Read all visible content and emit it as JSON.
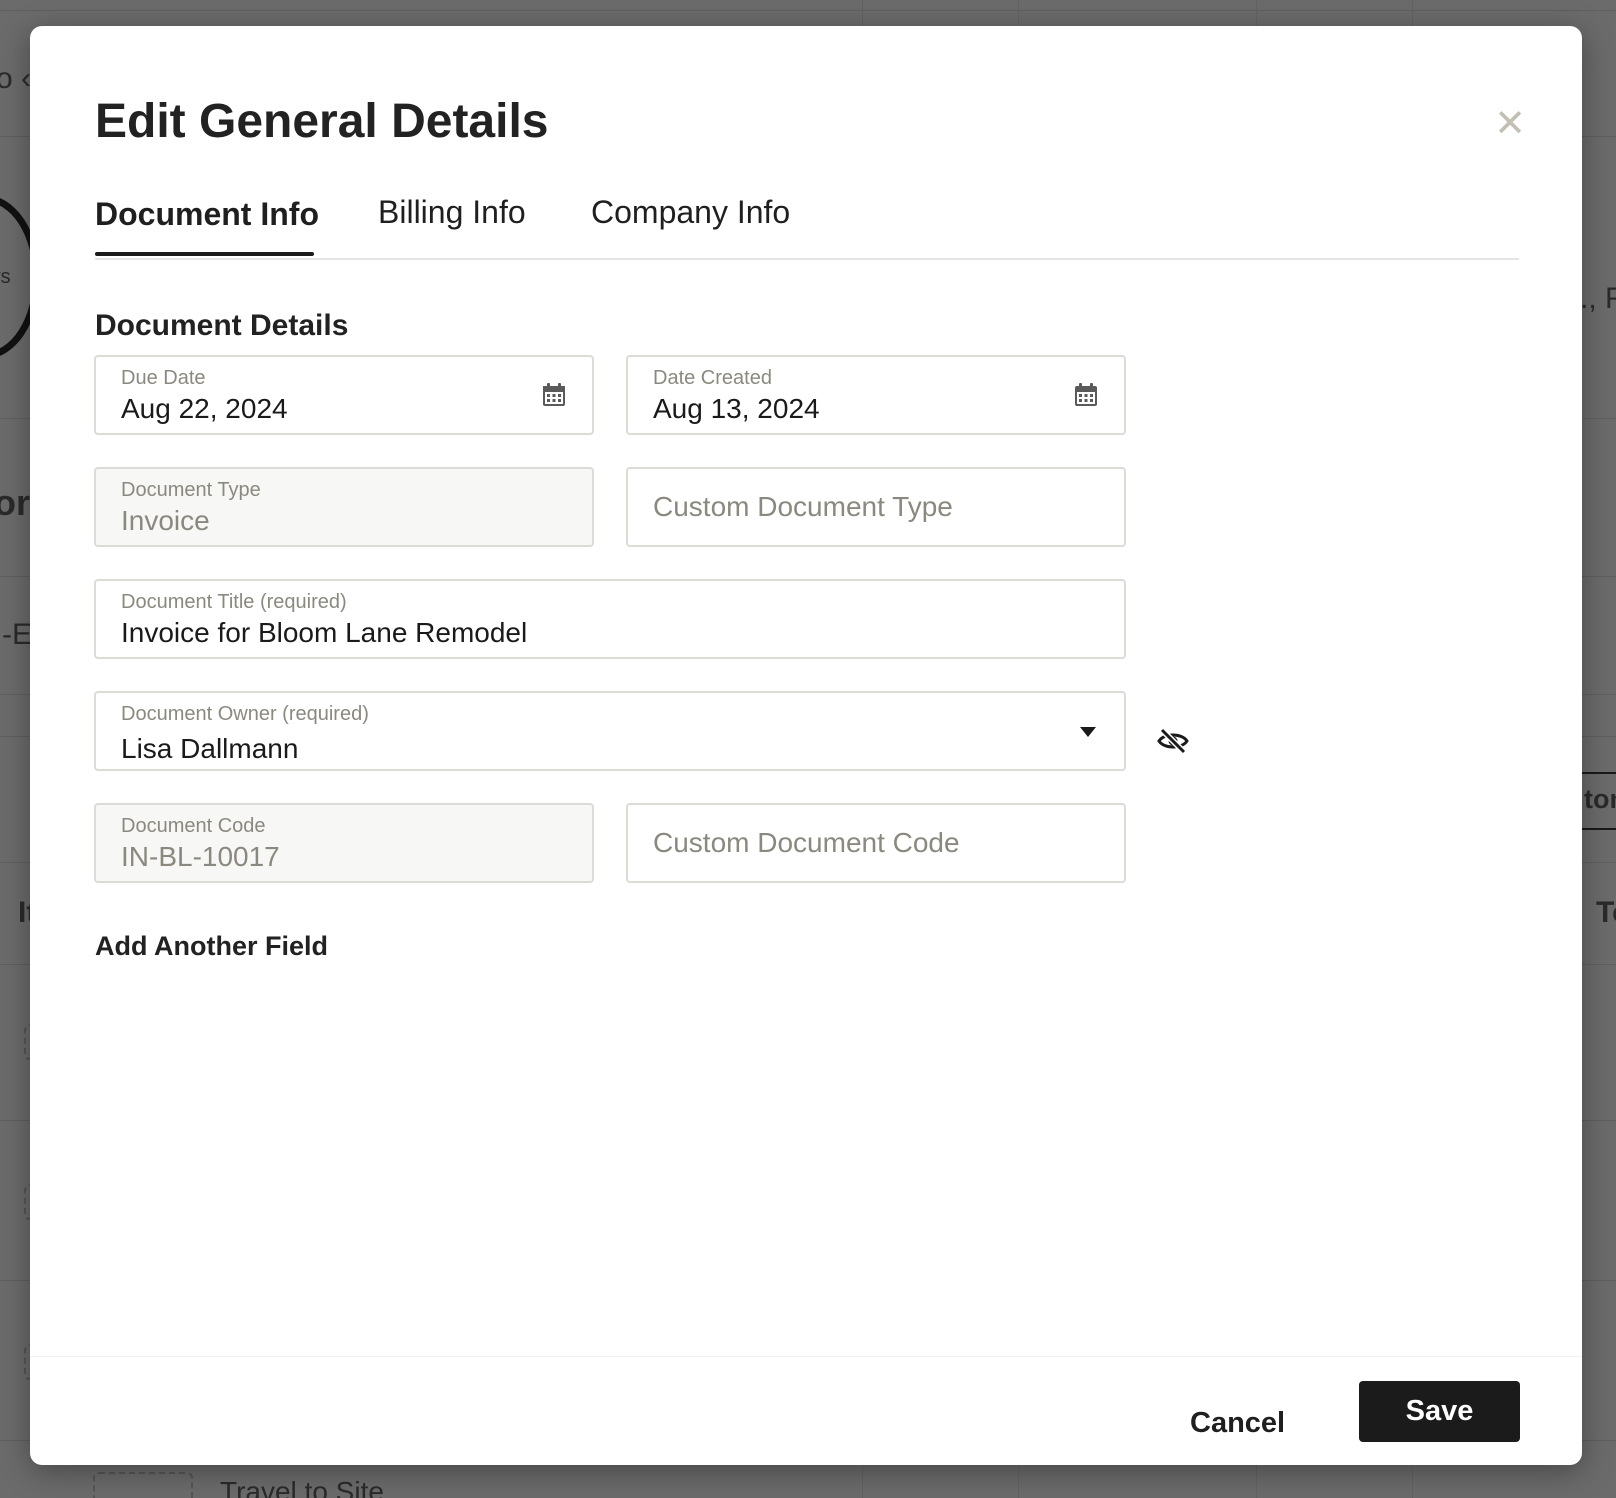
{
  "background": {
    "texts": [
      "o ‹",
      "rs",
      "or",
      "-E",
      "It",
      "., F",
      "Tc",
      "ton",
      "Travel to Site"
    ]
  },
  "modal": {
    "title": "Edit General Details",
    "close_icon": "close-icon",
    "tabs": [
      {
        "label": "Document Info",
        "active": true
      },
      {
        "label": "Billing Info",
        "active": false
      },
      {
        "label": "Company Info",
        "active": false
      }
    ],
    "section_title": "Document Details",
    "fields": {
      "due_date": {
        "label": "Due Date",
        "value": "Aug 22, 2024",
        "icon": "calendar-icon"
      },
      "date_created": {
        "label": "Date Created",
        "value": "Aug 13, 2024",
        "icon": "calendar-icon"
      },
      "document_type": {
        "label": "Document Type",
        "value": "Invoice"
      },
      "custom_document_type": {
        "placeholder": "Custom Document Type"
      },
      "document_title": {
        "label": "Document Title (required)",
        "value": "Invoice for Bloom Lane Remodel"
      },
      "document_owner": {
        "label": "Document Owner (required)",
        "value": "Lisa Dallmann",
        "icon": "chevron-down-icon"
      },
      "document_code": {
        "label": "Document Code",
        "value": "IN-BL-10017"
      },
      "custom_document_code": {
        "placeholder": "Custom Document Code"
      }
    },
    "visibility_icon": "eye-slash-icon",
    "add_field_label": "Add Another Field",
    "cancel_label": "Cancel",
    "save_label": "Save"
  },
  "colors": {
    "overlay": "#6b6b6b",
    "primary_button": "#1b1b1b",
    "field_border": "#dcdbd6",
    "muted_text": "#8b897f",
    "close_icon": "#c4bfb4"
  }
}
